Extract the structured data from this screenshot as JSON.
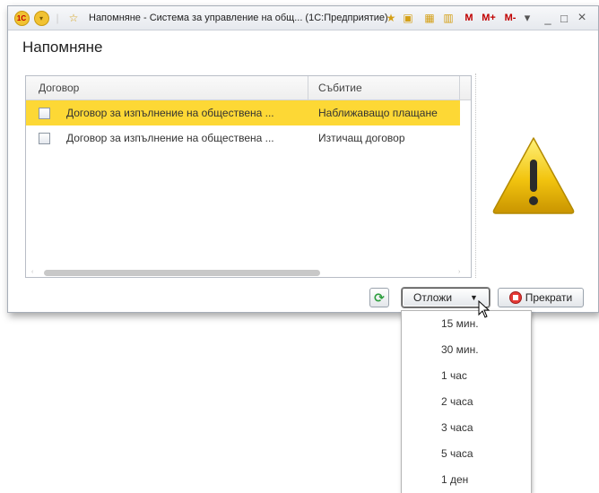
{
  "window": {
    "title": "Напомняне - Система за управление на общ... (1С:Предприятие)",
    "logo": "1С",
    "toolbar_m": "M",
    "toolbar_mplus": "M+",
    "toolbar_mminus": "M-",
    "minimize": "_",
    "maximize": "□",
    "close": "×"
  },
  "page": {
    "heading": "Напомняне"
  },
  "table": {
    "columns": [
      "Договор",
      "Събитие"
    ],
    "rows": [
      {
        "contract": "Договор за изпълнение на обществена ...",
        "event": "Наближаващо плащане",
        "selected": true,
        "checked": false
      },
      {
        "contract": "Договор за изпълнение на обществена ...",
        "event": "Изтичащ договор",
        "selected": false,
        "checked": false
      }
    ]
  },
  "buttons": {
    "postpone": "Отложи",
    "stop": "Прекрати"
  },
  "postpone_menu": [
    "15 мин.",
    "30 мин.",
    "1 час",
    "2 часа",
    "3 часа",
    "5 часа",
    "1 ден"
  ],
  "colors": {
    "selection": "#fdd835",
    "warning": "#f2c40f",
    "stop": "#e53935",
    "refresh": "#2e9e3e"
  }
}
